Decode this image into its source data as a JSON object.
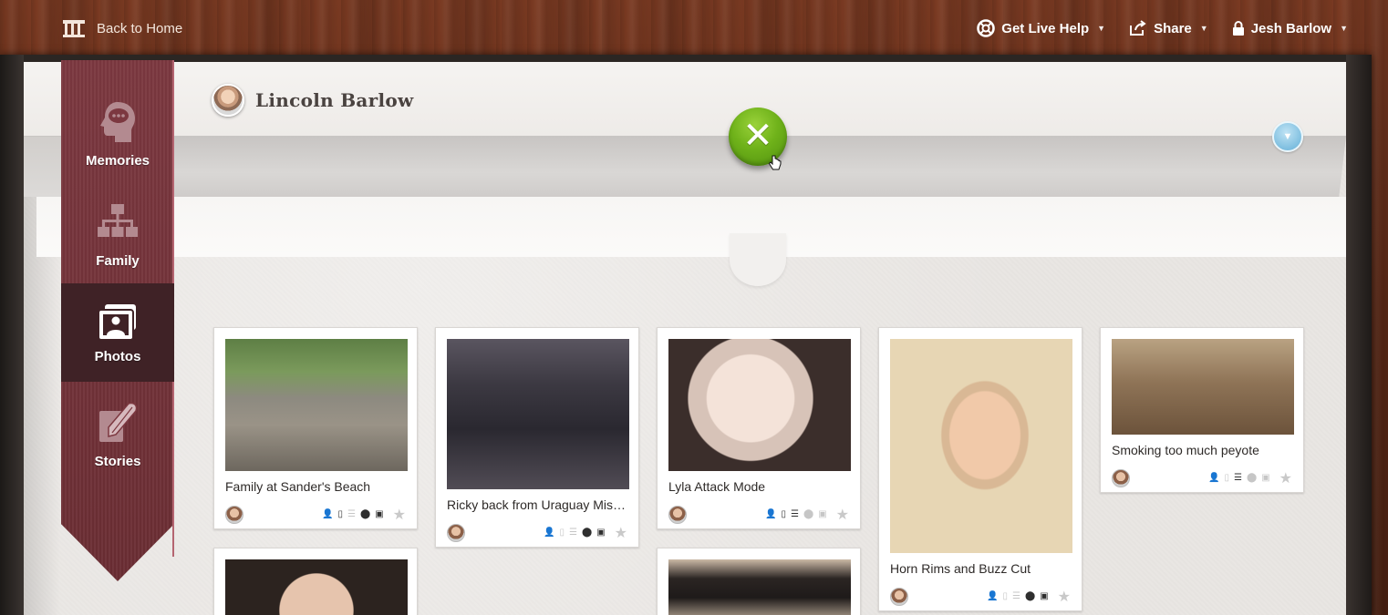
{
  "topbar": {
    "home_label": "Back to Home",
    "help_label": "Get Live Help",
    "share_label": "Share",
    "user_label": "Jesh Barlow"
  },
  "profile": {
    "name": "Lincoln Barlow"
  },
  "sidebar": {
    "items": [
      {
        "label": "Memories",
        "icon": "head-thought-icon",
        "active": false
      },
      {
        "label": "Family",
        "icon": "family-tree-icon",
        "active": false
      },
      {
        "label": "Photos",
        "icon": "photo-frame-icon",
        "active": true
      },
      {
        "label": "Stories",
        "icon": "quill-paper-icon",
        "active": false
      }
    ]
  },
  "close_glyph": "✕",
  "toggle_glyph": "▼",
  "star_glyph": "★",
  "photos": [
    {
      "title": "Family at Sander's Beach",
      "icons": [
        1,
        1,
        0,
        1,
        1
      ]
    },
    {
      "title": "Ricky back from Uraguay Mission",
      "icons": [
        0,
        0,
        0,
        1,
        1
      ]
    },
    {
      "title": "Lyla Attack Mode",
      "icons": [
        1,
        1,
        1,
        0,
        0
      ]
    },
    {
      "title": "Horn Rims and Buzz Cut",
      "icons": [
        0,
        0,
        0,
        1,
        1
      ]
    },
    {
      "title": "Smoking too much peyote",
      "icons": [
        1,
        0,
        1,
        0,
        0
      ]
    }
  ],
  "colors": {
    "ribbon": "#7c3840",
    "ribbon_active": "#3f2226",
    "close_button": "#6fb21a",
    "toggle": "#7fbfe0"
  }
}
